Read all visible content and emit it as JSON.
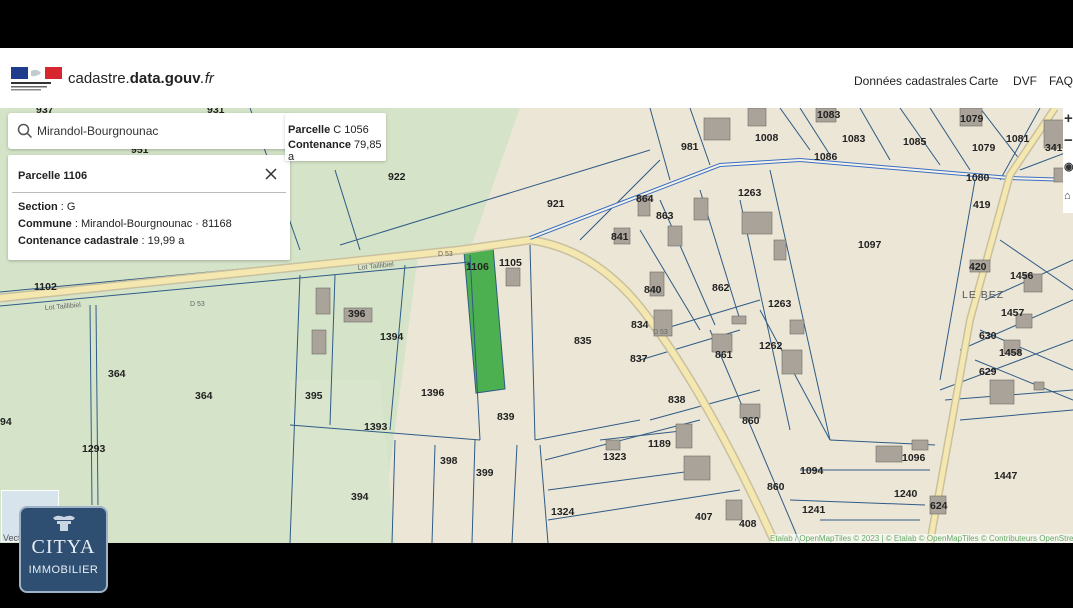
{
  "header": {
    "brand_prefix": "cadastre.",
    "brand_bold": "data.gouv",
    "brand_suffix": ".fr",
    "nav": [
      "Données cadastrales",
      "Carte",
      "DVF",
      "FAQ"
    ]
  },
  "search": {
    "value": "Mirandol-Bourgnounac"
  },
  "parcel_panel": {
    "title": "Parcelle 1106",
    "section_label": "Section",
    "section_value": " : G",
    "commune_label": "Commune",
    "commune_value": " : Mirandol-Bourgnounac · 81168",
    "contenance_label": "Contenance cadastrale",
    "contenance_value": " : 19,99 a"
  },
  "hover_popup": {
    "parcel_label": "Parcelle",
    "parcel_value": " C 1056",
    "contenance_label": "Contenance",
    "contenance_value": " 79,85 a"
  },
  "map": {
    "highlight_color": "#4caf50",
    "parcel_line_color": "#2f5b86",
    "road_color": "#f4e8b0",
    "labels": [
      "937",
      "931",
      "951",
      "922",
      "921",
      "864",
      "863",
      "841",
      "1105",
      "1106",
      "1102",
      "396",
      "1394",
      "364",
      "364",
      "395",
      "1393",
      "94",
      "1293",
      "1396",
      "839",
      "835",
      "834",
      "837",
      "840",
      "862",
      "1263",
      "1263",
      "1097",
      "1008",
      "1083",
      "1083",
      "1086",
      "1085",
      "1079",
      "1079",
      "1081",
      "341",
      "1080",
      "419",
      "420",
      "1456",
      "1457",
      "1458",
      "630",
      "629",
      "981",
      "861",
      "1262",
      "838",
      "860",
      "1189",
      "1323",
      "398",
      "399",
      "394",
      "1324",
      "407",
      "408",
      "860",
      "1094",
      "1096",
      "1240",
      "624",
      "1241",
      "1447"
    ],
    "place_label": "LE BEZ",
    "road_labels": [
      "Lot Taillibiel",
      "Lot Taillibiel",
      "D 53",
      "D 53",
      "D 53"
    ]
  },
  "attribution": "Etalab / OpenMapTiles © 2023 | © Etalab © OpenMapTiles © Contributeurs OpenStreetMap",
  "minimap_label": "Vecto",
  "watermark": {
    "line1": "CITYA",
    "line2": "IMMOBILIER"
  }
}
